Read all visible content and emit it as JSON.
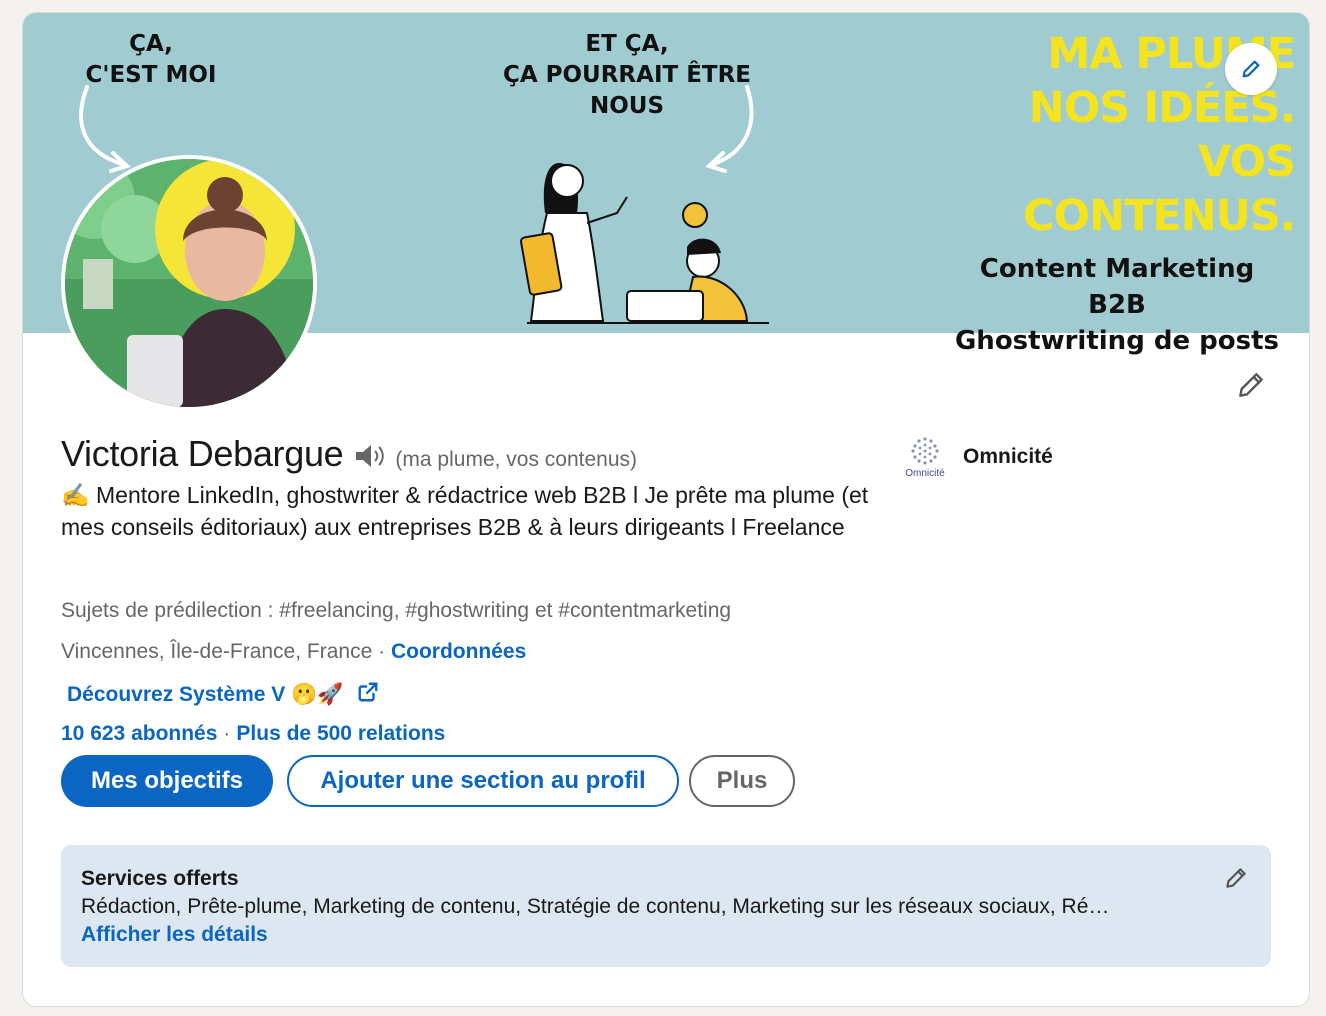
{
  "banner": {
    "left_text": "ÇA,\nC'EST MOI",
    "mid_text": "ET ÇA,\nÇA POURRAIT ÊTRE\nNOUS",
    "right_yellow": "MA PLUME\nNOS IDÉES.\nVOS CONTENUS.",
    "right_black": "Content Marketing B2B\nGhostwriting de posts",
    "colors": {
      "background": "#a0cbd1",
      "yellow": "#f4e41f"
    }
  },
  "profile": {
    "name": "Victoria Debargue",
    "pronunciation": "(ma plume, vos contenus)",
    "headline": "✍️ Mentore LinkedIn, ghostwriter & rédactrice web B2B l Je prête ma plume (et mes conseils éditoriaux) aux entreprises B2B & à leurs dirigeants l Freelance",
    "topics": "Sujets de prédilection : #freelancing, #ghostwriting et #contentmarketing",
    "location": "Vincennes, Île-de-France, France",
    "location_sep": " · ",
    "contact_link": "Coordonnées",
    "website": "Découvrez Système V 🫢🚀",
    "followers": "10 623 abonnés",
    "stats_sep": "·",
    "connections": "Plus de 500 relations"
  },
  "company": {
    "logo_caption": "Omnicité",
    "name": "Omnicité"
  },
  "actions": {
    "primary": "Mes objectifs",
    "add_section": "Ajouter une section au profil",
    "more": "Plus"
  },
  "services": {
    "title": "Services offerts",
    "list": "Rédaction, Prête-plume, Marketing de contenu, Stratégie de contenu, Marketing sur les réseaux sociaux, Ré…",
    "details_link": "Afficher les détails"
  },
  "icons": {
    "banner_edit": "pencil-icon",
    "profile_edit": "pencil-icon",
    "speaker": "speaker-icon",
    "external_link": "external-link-icon"
  },
  "theme": {
    "link": "#0a66c2",
    "muted": "#666666",
    "text": "#191919"
  }
}
